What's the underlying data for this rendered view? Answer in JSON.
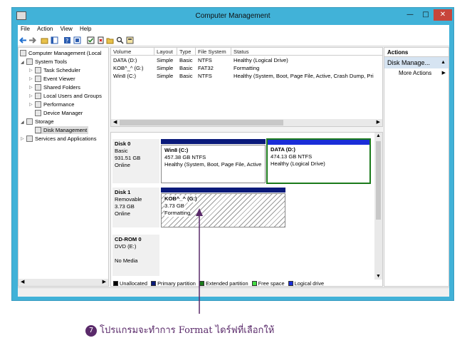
{
  "window": {
    "title": "Computer Management"
  },
  "menu": [
    "File",
    "Action",
    "View",
    "Help"
  ],
  "tree": [
    {
      "label": "Computer Management (Local",
      "icon": "computer-icon"
    },
    {
      "label": "System Tools",
      "icon": "tools-icon"
    },
    {
      "label": "Task Scheduler",
      "icon": "clock-icon"
    },
    {
      "label": "Event Viewer",
      "icon": "event-viewer-icon"
    },
    {
      "label": "Shared Folders",
      "icon": "folder-icon"
    },
    {
      "label": "Local Users and Groups",
      "icon": "users-icon"
    },
    {
      "label": "Performance",
      "icon": "performance-icon"
    },
    {
      "label": "Device Manager",
      "icon": "device-manager-icon"
    },
    {
      "label": "Storage",
      "icon": "storage-icon"
    },
    {
      "label": "Disk Management",
      "icon": "disk-icon"
    },
    {
      "label": "Services and Applications",
      "icon": "services-icon"
    }
  ],
  "volume_list": {
    "columns": [
      "Volume",
      "Layout",
      "Type",
      "File System",
      "Status"
    ],
    "rows": [
      [
        "DATA (D:)",
        "Simple",
        "Basic",
        "NTFS",
        "Healthy (Logical Drive)"
      ],
      [
        "KOB^_^ (G:)",
        "Simple",
        "Basic",
        "FAT32",
        "Formatting"
      ],
      [
        "Win8 (C:)",
        "Simple",
        "Basic",
        "NTFS",
        "Healthy (System, Boot, Page File, Active, Crash Dump, Pri"
      ]
    ]
  },
  "disks": {
    "disk0": {
      "name": "Disk 0",
      "type": "Basic",
      "size": "931.51 GB",
      "state": "Online",
      "p1": {
        "name": "Win8  (C:)",
        "size": "457.38 GB NTFS",
        "status": "Healthy (System, Boot, Page File, Active"
      },
      "p2": {
        "name": "DATA  (D:)",
        "size": "474.13 GB NTFS",
        "status": "Healthy (Logical Drive)"
      }
    },
    "disk1": {
      "name": "Disk 1",
      "type": "Removable",
      "size": "3.73 GB",
      "state": "Online",
      "p1": {
        "name": "KOB^_^  (G:)",
        "size": "3.73 GB",
        "status": "Formatting"
      }
    },
    "cdrom": {
      "name": "CD-ROM 0",
      "type": "DVD (E:)",
      "state": "No Media"
    }
  },
  "legend": [
    {
      "label": "Unallocated",
      "color": "#000000"
    },
    {
      "label": "Primary partition",
      "color": "#0a1a7a"
    },
    {
      "label": "Extended partition",
      "color": "#1b7a1b"
    },
    {
      "label": "Free space",
      "color": "#44dd44"
    },
    {
      "label": "Logical drive",
      "color": "#1a2ed8"
    }
  ],
  "actions": {
    "header": "Actions",
    "section": "Disk Manage...",
    "item": "More Actions"
  },
  "caption": {
    "number": "7",
    "text": "โปรแกรมจะทำการ Format ไดร์ฟที่เลือกให้"
  }
}
